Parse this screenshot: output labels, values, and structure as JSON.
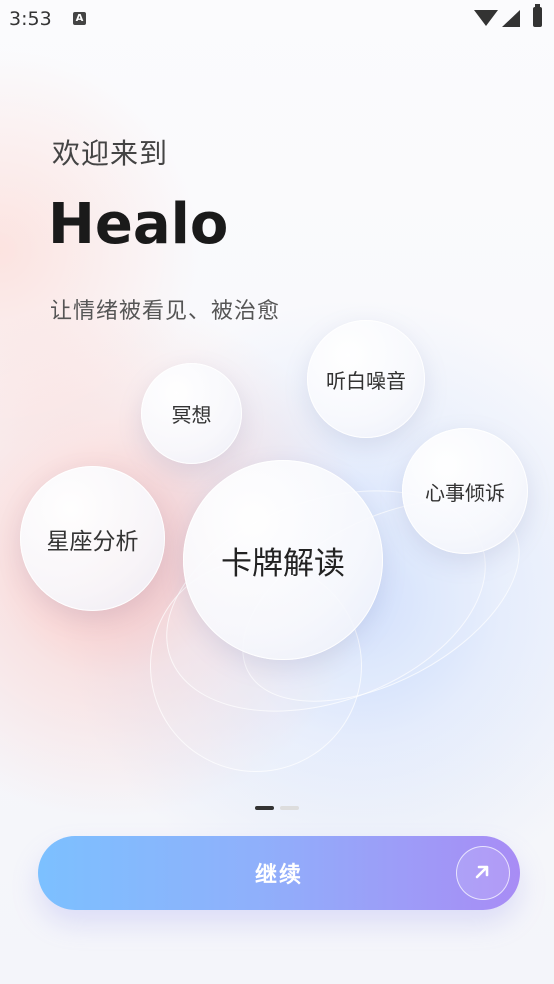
{
  "status_bar": {
    "time": "3:53",
    "notification_icon": "A"
  },
  "hero": {
    "welcome": "欢迎来到",
    "brand": "Healo",
    "tagline": "让情绪被看见、被治愈"
  },
  "bubbles": {
    "meditation": "冥想",
    "white_noise": "听白噪音",
    "confide": "心事倾诉",
    "astrology": "星座分析",
    "tarot": "卡牌解读"
  },
  "pager": {
    "current": 1,
    "total": 2
  },
  "continue_button": {
    "label": "继续"
  },
  "colors": {
    "button_start": "#7cc0ff",
    "button_end": "#a88cf5",
    "accent_red": "#ff968c",
    "accent_blue": "#8cb4ff"
  }
}
